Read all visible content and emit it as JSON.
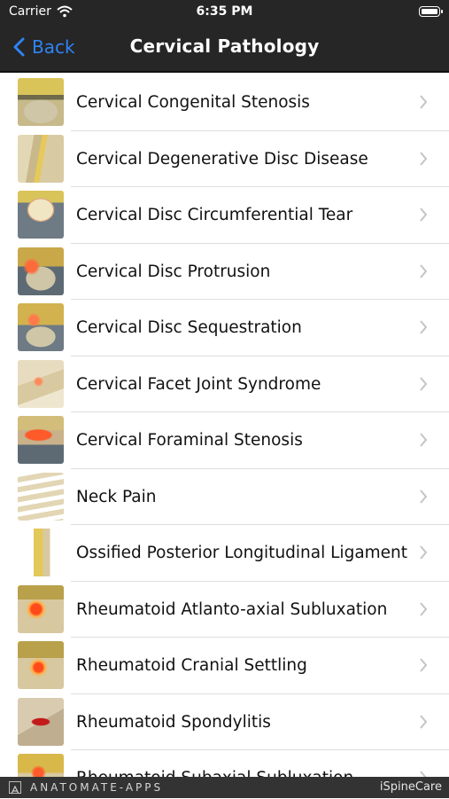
{
  "status_bar": {
    "carrier": "Carrier",
    "time": "6:35 PM"
  },
  "nav": {
    "back_label": "Back",
    "title": "Cervical Pathology"
  },
  "items": [
    {
      "label": "Cervical Congenital Stenosis",
      "icon": "vertebra-axial-thumbnail"
    },
    {
      "label": "Cervical Degenerative Disc Disease",
      "icon": "spine-lateral-thumbnail"
    },
    {
      "label": "Cervical Disc Circumferential Tear",
      "icon": "disc-axial-thumbnail"
    },
    {
      "label": "Cervical Disc Protrusion",
      "icon": "disc-protrusion-thumbnail"
    },
    {
      "label": "Cervical Disc Sequestration",
      "icon": "disc-sequestration-thumbnail"
    },
    {
      "label": "Cervical Facet Joint Syndrome",
      "icon": "facet-joint-thumbnail"
    },
    {
      "label": "Cervical Foraminal Stenosis",
      "icon": "foraminal-stenosis-thumbnail"
    },
    {
      "label": "Neck Pain",
      "icon": "cervical-spine-thumbnail"
    },
    {
      "label": "Ossified Posterior Longitudinal Ligament",
      "icon": "spine-ligament-thumbnail"
    },
    {
      "label": "Rheumatoid Atlanto-axial Subluxation",
      "icon": "atlanto-axial-thumbnail"
    },
    {
      "label": "Rheumatoid Cranial Settling",
      "icon": "cranial-settling-thumbnail"
    },
    {
      "label": "Rheumatoid Spondylitis",
      "icon": "spondylitis-thumbnail"
    },
    {
      "label": "Rheumatoid Subaxial Subluxation",
      "icon": "subaxial-thumbnail"
    }
  ],
  "footer": {
    "brand": "ANATOMATE-APPS",
    "app_name": "iSpineCare"
  },
  "colors": {
    "accent": "#2f84f4",
    "bar": "#262626",
    "footer": "#333333"
  }
}
